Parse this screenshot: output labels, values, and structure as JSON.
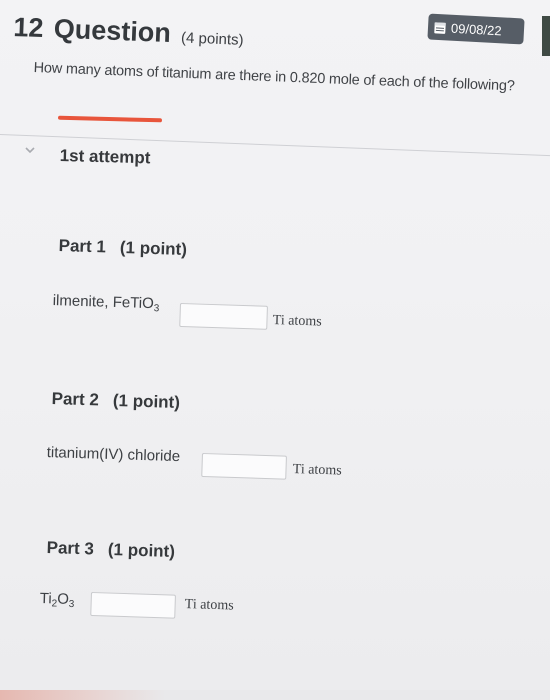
{
  "header": {
    "date": "09/08/22",
    "question_number": "12",
    "question_word": "Question",
    "points": "(4 points)"
  },
  "question": {
    "text": "How many atoms of titanium are there in 0.820 mole of each of the following?"
  },
  "attempt": {
    "label": "1st attempt"
  },
  "parts": [
    {
      "title": "Part 1",
      "points": "(1 point)",
      "label_main": "ilmenite, FeTiO",
      "label_sub": "3",
      "answer_value": "",
      "unit": "Ti atoms"
    },
    {
      "title": "Part 2",
      "points": "(1 point)",
      "label_main": "titanium(IV) chloride",
      "answer_value": "",
      "unit": "Ti atoms"
    },
    {
      "title": "Part 3",
      "points": "(1 point)",
      "label_a": "Ti",
      "label_sub1": "2",
      "label_b": "O",
      "label_sub2": "3",
      "answer_value": "",
      "unit": "Ti atoms"
    }
  ],
  "colors": {
    "accent": "#e8553b",
    "badge": "#565d66",
    "background": "#f1f1f3"
  },
  "icons": {
    "badge_icon": "calendar-icon",
    "expand_icon": "chevron-down-icon"
  }
}
